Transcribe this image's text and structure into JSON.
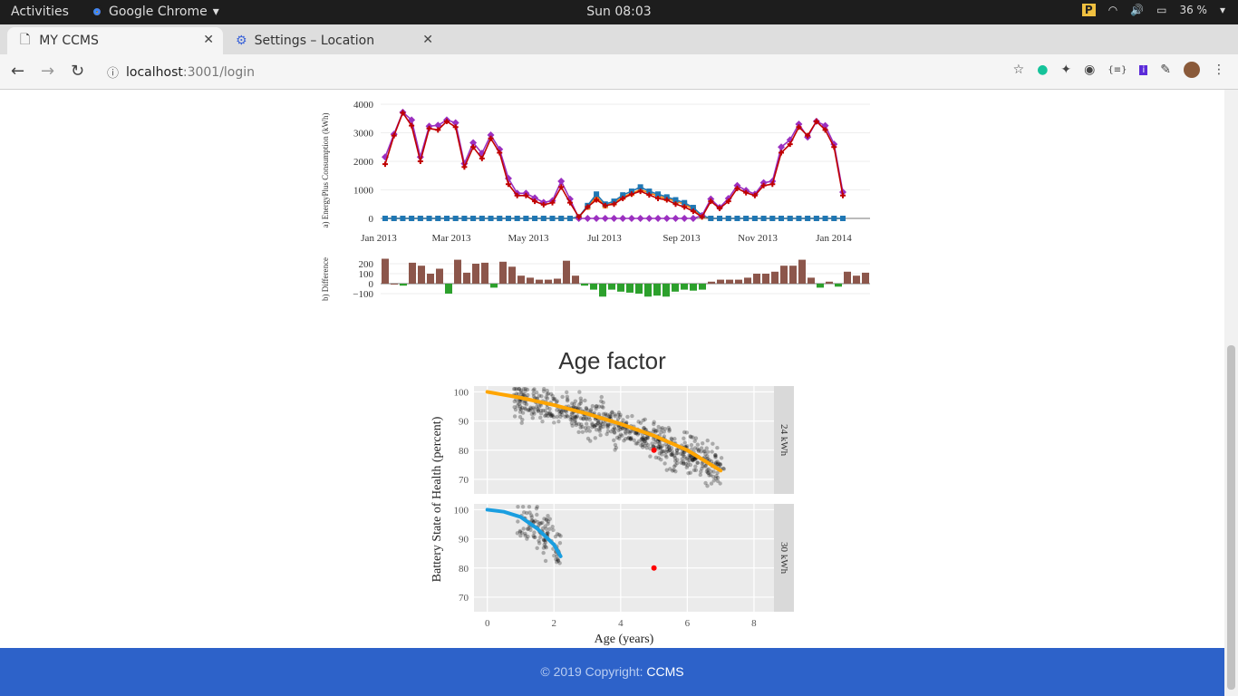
{
  "system": {
    "activities": "Activities",
    "app_name": "Google Chrome",
    "clock": "Sun 08:03",
    "battery": "36 %"
  },
  "browser": {
    "tabs": [
      {
        "label": "MY CCMS"
      },
      {
        "label": "Settings – Location"
      }
    ],
    "url_host": "localhost",
    "url_rest": ":3001/login"
  },
  "footer": {
    "text": "© 2019 Copyright: ",
    "brand": "CCMS"
  },
  "page": {
    "age_title": "Age factor"
  },
  "chart_data": [
    {
      "type": "line",
      "ylabel": "a) EnergyPlus Consumption (kWh)",
      "yticks": [
        0,
        1000,
        2000,
        3000,
        4000
      ],
      "ylim": [
        0,
        4000
      ],
      "xticks": [
        "Jan 2013",
        "Mar 2013",
        "May 2013",
        "Jul 2013",
        "Sep 2013",
        "Nov 2013",
        "Jan 2014"
      ],
      "n": 55,
      "series": [
        {
          "color": "#c00000",
          "marker": "cross",
          "values": [
            1900,
            2900,
            3700,
            3250,
            2000,
            3150,
            3100,
            3400,
            3200,
            1800,
            2500,
            2100,
            2800,
            2300,
            1200,
            800,
            800,
            600,
            480,
            550,
            1100,
            550,
            50,
            400,
            650,
            450,
            500,
            700,
            850,
            950,
            820,
            700,
            650,
            500,
            400,
            250,
            50,
            600,
            350,
            600,
            1050,
            900,
            800,
            1150,
            1200,
            2300,
            2600,
            3200,
            2900,
            3400,
            3100,
            2500,
            800
          ]
        },
        {
          "color": "#9b30c0",
          "marker": "diamond",
          "values": [
            2150,
            2950,
            3720,
            3450,
            2150,
            3230,
            3260,
            3450,
            3350,
            1920,
            2650,
            2280,
            2920,
            2420,
            1400,
            880,
            880,
            720,
            560,
            620,
            1300,
            680,
            0,
            0,
            0,
            0,
            0,
            0,
            0,
            0,
            0,
            0,
            0,
            0,
            0,
            0,
            100,
            680,
            380,
            700,
            1150,
            980,
            850,
            1250,
            1300,
            2500,
            2750,
            3300,
            2850,
            3400,
            3250,
            2600,
            920
          ]
        },
        {
          "color": "#1f77b4",
          "marker": "square",
          "values": [
            0,
            0,
            0,
            0,
            0,
            0,
            0,
            0,
            0,
            0,
            0,
            0,
            0,
            0,
            0,
            0,
            0,
            0,
            0,
            0,
            0,
            0,
            50,
            450,
            850,
            500,
            600,
            820,
            950,
            1100,
            950,
            850,
            750,
            650,
            550,
            380,
            100,
            0,
            0,
            0,
            0,
            0,
            0,
            0,
            0,
            0,
            0,
            0,
            0,
            0,
            0,
            0,
            0
          ]
        },
        {
          "color": "#ff7f0e",
          "marker": "square",
          "values": [
            0,
            0,
            0,
            0,
            0,
            0,
            0,
            0,
            0,
            0,
            0,
            0,
            0,
            0,
            0,
            0,
            0,
            0,
            0,
            0,
            0,
            0,
            50,
            400,
            750,
            450,
            550,
            750,
            880,
            1000,
            900,
            780,
            700,
            600,
            500,
            320,
            80,
            0,
            0,
            0,
            0,
            0,
            0,
            0,
            0,
            0,
            0,
            0,
            0,
            0,
            0,
            0,
            0
          ]
        }
      ]
    },
    {
      "type": "bar",
      "ylabel": "b) Difference",
      "yticks": [
        -100,
        0,
        100,
        200
      ],
      "values": [
        250,
        0,
        -20,
        210,
        180,
        100,
        150,
        -100,
        240,
        110,
        200,
        210,
        -40,
        220,
        170,
        80,
        60,
        40,
        40,
        50,
        230,
        80,
        -20,
        -60,
        -130,
        -60,
        -80,
        -90,
        -100,
        -130,
        -120,
        -130,
        -80,
        -60,
        -70,
        -60,
        20,
        40,
        40,
        40,
        60,
        100,
        100,
        120,
        180,
        180,
        240,
        60,
        -40,
        20,
        -30,
        120,
        80,
        110
      ],
      "colors": {
        "positive": "#8c564b",
        "negative": "#2ca02c"
      }
    },
    {
      "type": "scatter",
      "ylabel": "Battery State of Health (percent)",
      "xlabel": "Age (years)",
      "xticks": [
        0,
        2,
        4,
        6,
        8
      ],
      "yticks": [
        70,
        80,
        90,
        100
      ],
      "xlim": [
        -0.4,
        8.6
      ],
      "ylim": [
        65,
        102
      ],
      "panels": [
        {
          "label": "24 kWh",
          "fit_color": "#ffa500",
          "fit": [
            [
              0,
              100
            ],
            [
              1,
              98
            ],
            [
              2,
              95.5
            ],
            [
              3,
              92.5
            ],
            [
              4,
              89
            ],
            [
              5,
              85
            ],
            [
              6,
              80
            ],
            [
              7,
              73
            ]
          ],
          "highlight": [
            5,
            80
          ]
        },
        {
          "label": "30 kWh",
          "fit_color": "#1a9ee0",
          "fit": [
            [
              0,
              100
            ],
            [
              0.5,
              99.3
            ],
            [
              1,
              97.5
            ],
            [
              1.5,
              93.5
            ],
            [
              2,
              88
            ],
            [
              2.2,
              84
            ]
          ],
          "highlight": [
            5,
            80
          ]
        }
      ]
    }
  ]
}
